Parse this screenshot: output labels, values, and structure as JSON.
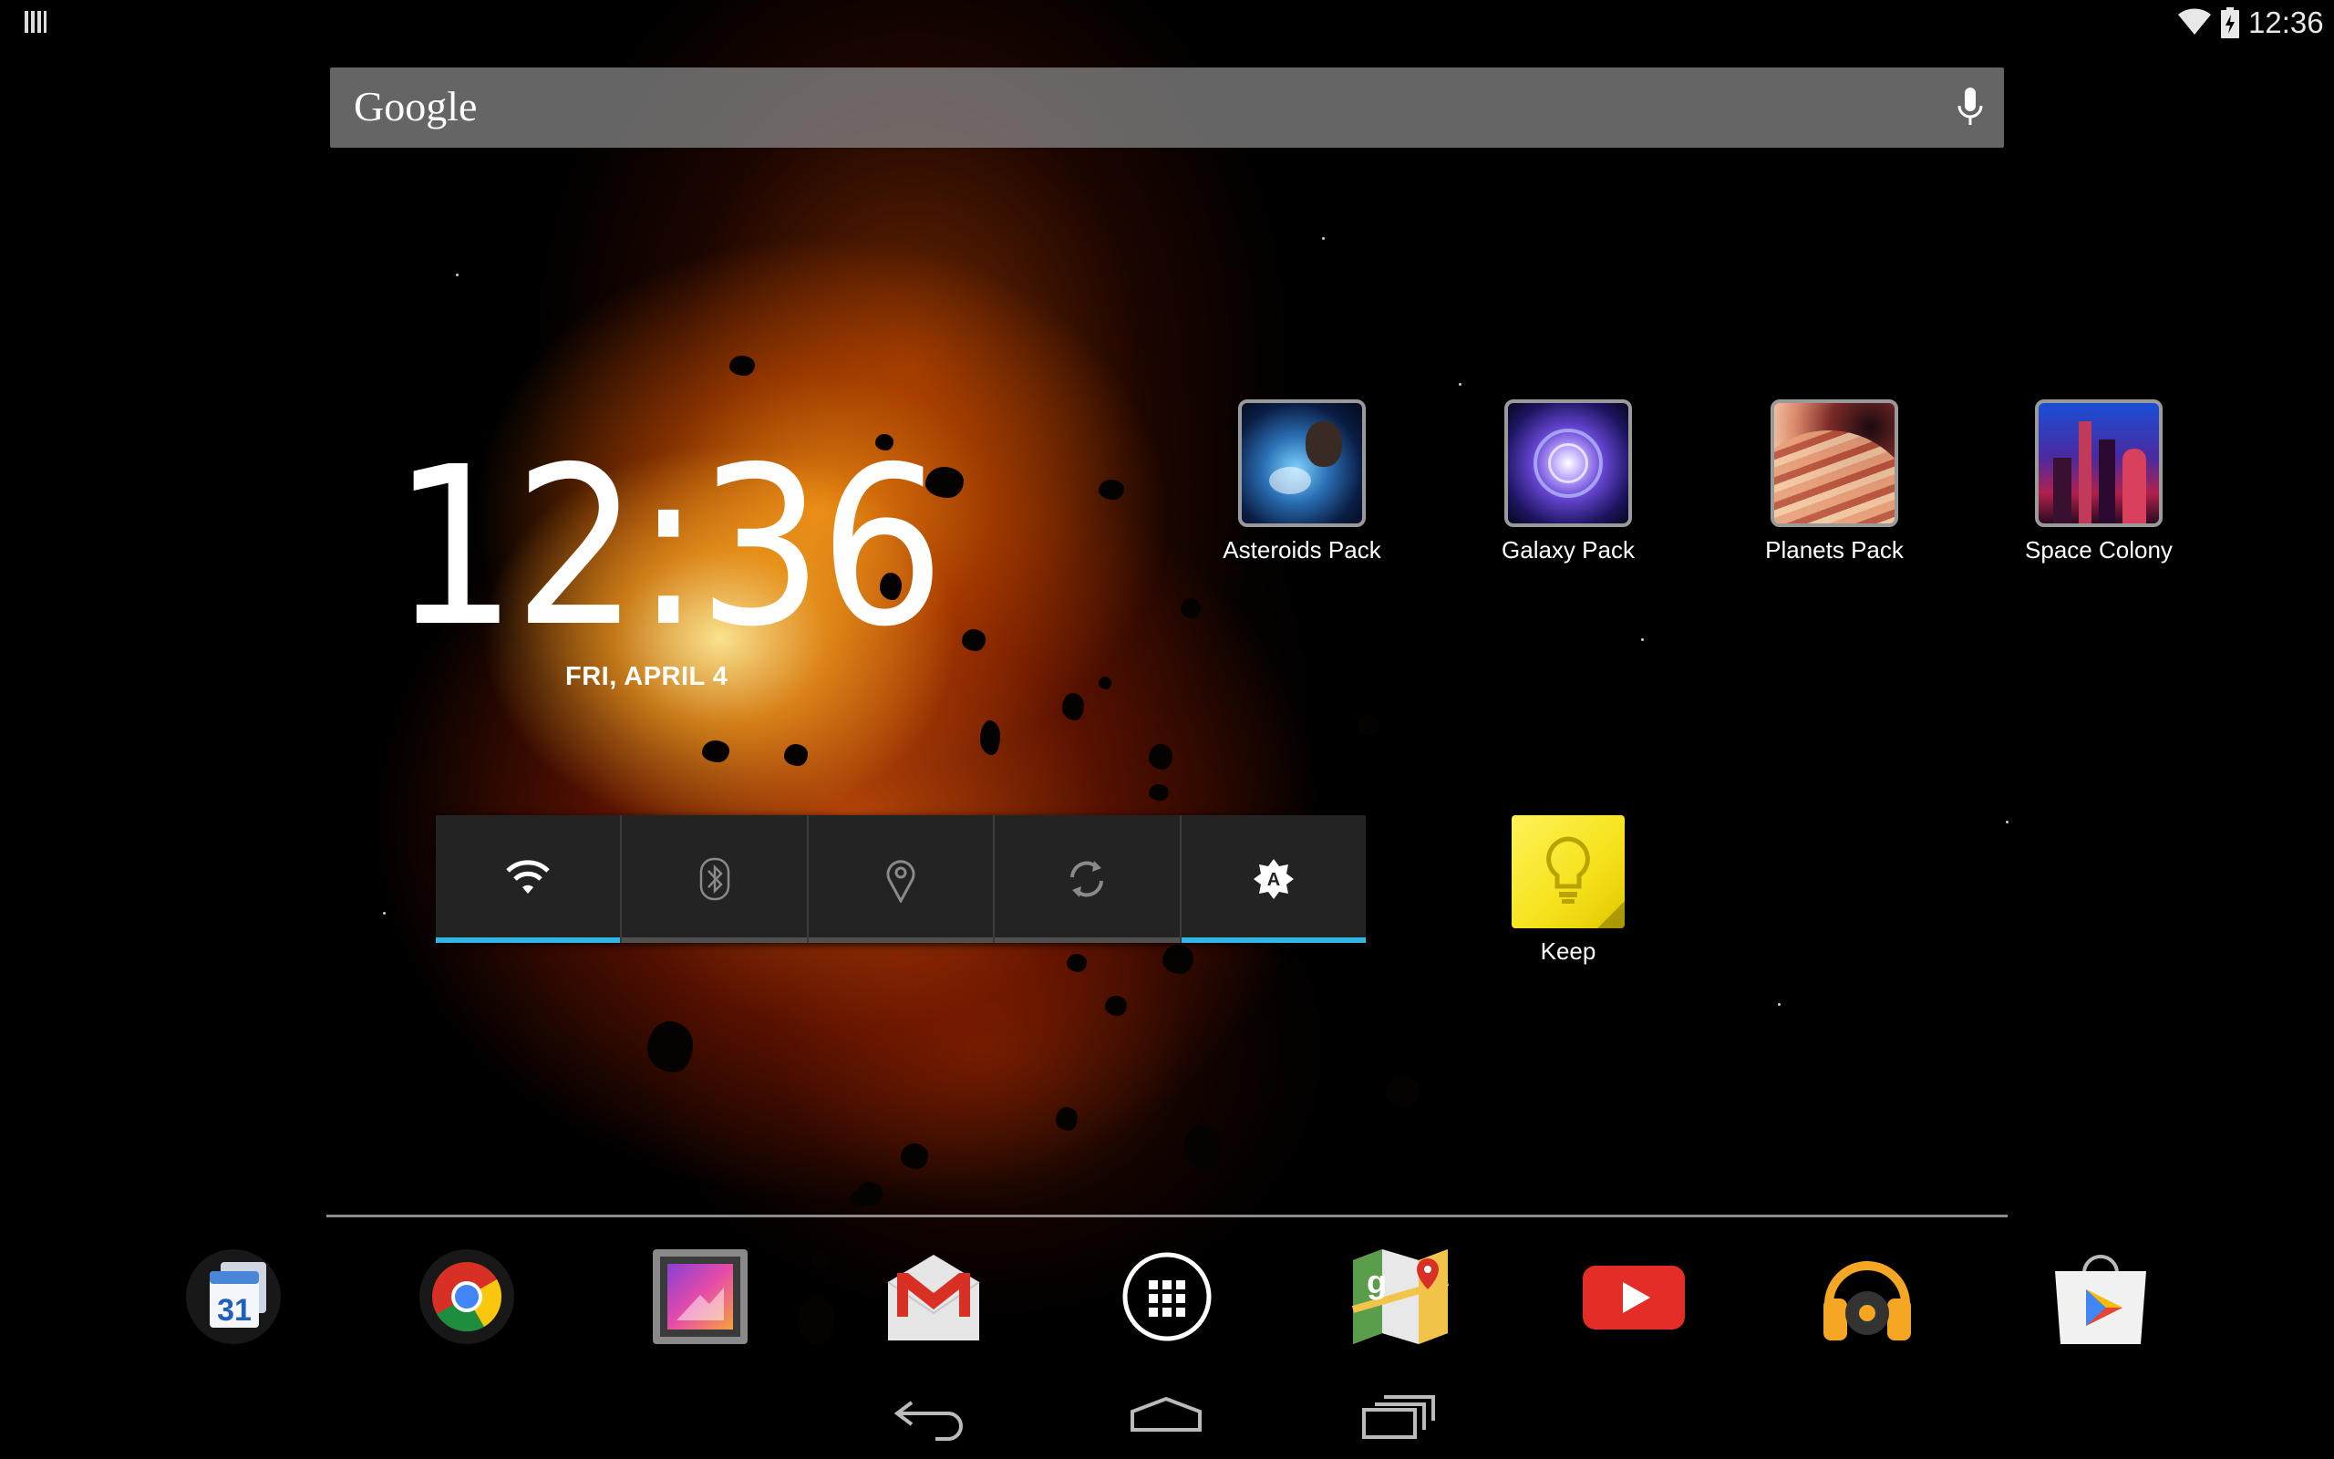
{
  "status_bar": {
    "time": "12:36",
    "icons": [
      "notification-icon",
      "wifi-icon",
      "battery-charging-icon"
    ]
  },
  "search": {
    "logo": "Google",
    "voice_icon": "mic-icon"
  },
  "clock": {
    "time": "12:36",
    "date": "FRI, APRIL 4"
  },
  "apps": [
    {
      "label": "Asteroids Pack",
      "icon": "asteroids-pack-icon"
    },
    {
      "label": "Galaxy Pack",
      "icon": "galaxy-pack-icon"
    },
    {
      "label": "Planets Pack",
      "icon": "planets-pack-icon"
    },
    {
      "label": "Space Colony",
      "icon": "space-colony-icon"
    },
    {
      "label": "Keep",
      "icon": "keep-icon"
    }
  ],
  "power_widget": {
    "buttons": [
      {
        "name": "wifi",
        "state": "on",
        "icon": "wifi-icon"
      },
      {
        "name": "bluetooth",
        "state": "off",
        "icon": "bluetooth-icon"
      },
      {
        "name": "location",
        "state": "off",
        "icon": "location-icon"
      },
      {
        "name": "sync",
        "state": "off",
        "icon": "sync-icon"
      },
      {
        "name": "brightness",
        "state": "on",
        "icon": "auto-brightness-icon"
      }
    ],
    "accent_color": "#33b5e5"
  },
  "dock": {
    "items": [
      "calendar-icon",
      "chrome-icon",
      "gallery-icon",
      "gmail-icon",
      "app-drawer-icon",
      "maps-icon",
      "youtube-icon",
      "play-music-icon",
      "play-store-icon"
    ],
    "calendar_day": "31"
  },
  "nav_bar": {
    "buttons": [
      "back-icon",
      "home-icon",
      "recents-icon"
    ]
  }
}
